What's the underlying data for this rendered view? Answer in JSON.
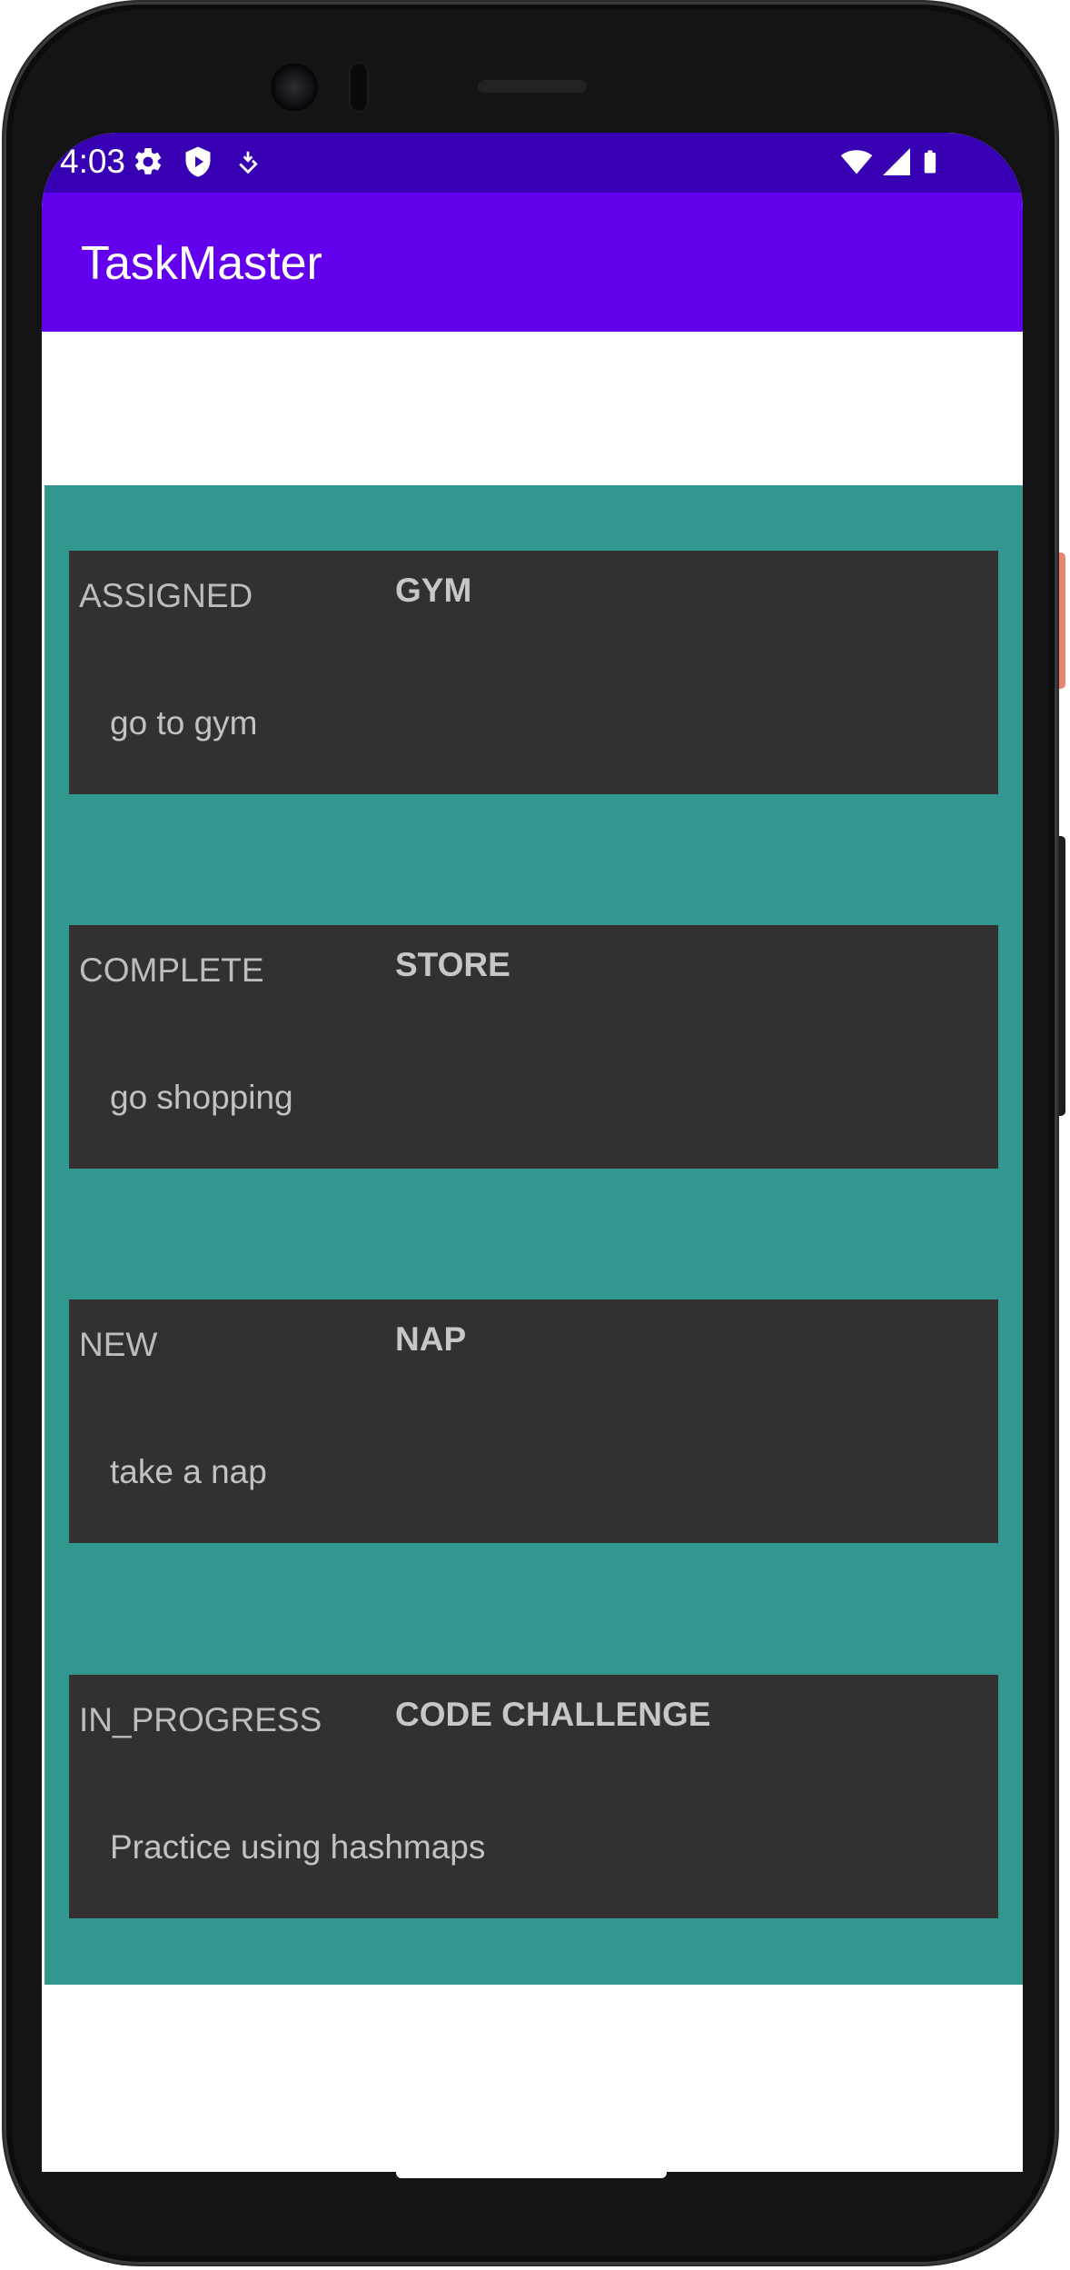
{
  "status_bar": {
    "time": "4:03",
    "left_icons": [
      "gear-icon",
      "shield-play-icon",
      "download-icon"
    ],
    "right_icons": [
      "wifi-icon",
      "signal-icon",
      "battery-icon"
    ]
  },
  "app_bar": {
    "title": "TaskMaster"
  },
  "colors": {
    "status_bar": "#3700b3",
    "app_bar": "#6200ee",
    "list_background": "#31978f",
    "card_background": "#323031"
  },
  "tasks": [
    {
      "state": "ASSIGNED",
      "title": "GYM",
      "body": "go to gym"
    },
    {
      "state": "COMPLETE",
      "title": "STORE",
      "body": "go shopping"
    },
    {
      "state": "NEW",
      "title": "NAP",
      "body": "take a nap"
    },
    {
      "state": "IN_PROGRESS",
      "title": "CODE CHALLENGE",
      "body": "Practice using hashmaps"
    }
  ]
}
